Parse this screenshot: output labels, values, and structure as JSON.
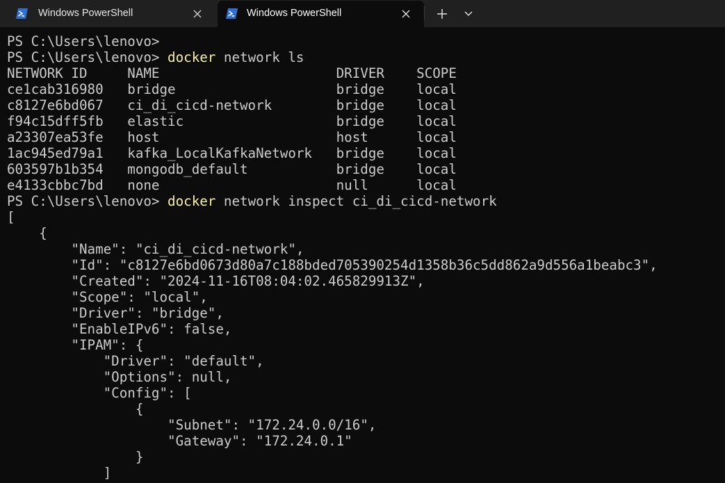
{
  "tabs": [
    {
      "title": "Windows PowerShell",
      "active": false
    },
    {
      "title": "Windows PowerShell",
      "active": true
    }
  ],
  "colors": {
    "background": "#0c0c0c",
    "tabbar": "#202020",
    "text": "#cccccc",
    "command": "#f9f1a5",
    "ps_icon_bg": "#2f6fd6"
  },
  "icons": {
    "tab_icon": "powershell-icon",
    "close": "close-icon",
    "new_tab": "plus-icon",
    "dropdown": "chevron-down-icon"
  },
  "terminal": {
    "lines": [
      {
        "segments": [
          {
            "text": "PS C:\\Users\\lenovo>"
          }
        ]
      },
      {
        "segments": [
          {
            "text": "PS C:\\Users\\lenovo> "
          },
          {
            "text": "docker",
            "style": "cmd"
          },
          {
            "text": " network ls"
          }
        ]
      },
      {
        "segments": [
          {
            "text": "NETWORK ID     NAME                      DRIVER    SCOPE"
          }
        ]
      },
      {
        "segments": [
          {
            "text": "ce1cab316980   bridge                    bridge    local"
          }
        ]
      },
      {
        "segments": [
          {
            "text": "c8127e6bd067   ci_di_cicd-network        bridge    local"
          }
        ]
      },
      {
        "segments": [
          {
            "text": "f94c15dff5fb   elastic                   bridge    local"
          }
        ]
      },
      {
        "segments": [
          {
            "text": "a23307ea53fe   host                      host      local"
          }
        ]
      },
      {
        "segments": [
          {
            "text": "1ac945ed79a1   kafka_LocalKafkaNetwork   bridge    local"
          }
        ]
      },
      {
        "segments": [
          {
            "text": "603597b1b354   mongodb_default           bridge    local"
          }
        ]
      },
      {
        "segments": [
          {
            "text": "e4133cbbc7bd   none                      null      local"
          }
        ]
      },
      {
        "segments": [
          {
            "text": "PS C:\\Users\\lenovo> "
          },
          {
            "text": "docker",
            "style": "cmd"
          },
          {
            "text": " network inspect ci_di_cicd-network"
          }
        ]
      },
      {
        "segments": [
          {
            "text": "["
          }
        ]
      },
      {
        "segments": [
          {
            "text": "    {"
          }
        ]
      },
      {
        "segments": [
          {
            "text": "        \"Name\": \"ci_di_cicd-network\","
          }
        ]
      },
      {
        "segments": [
          {
            "text": "        \"Id\": \"c8127e6bd0673d80a7c188bded705390254d1358b36c5dd862a9d556a1beabc3\","
          }
        ]
      },
      {
        "segments": [
          {
            "text": "        \"Created\": \"2024-11-16T08:04:02.465829913Z\","
          }
        ]
      },
      {
        "segments": [
          {
            "text": "        \"Scope\": \"local\","
          }
        ]
      },
      {
        "segments": [
          {
            "text": "        \"Driver\": \"bridge\","
          }
        ]
      },
      {
        "segments": [
          {
            "text": "        \"EnableIPv6\": false,"
          }
        ]
      },
      {
        "segments": [
          {
            "text": "        \"IPAM\": {"
          }
        ]
      },
      {
        "segments": [
          {
            "text": "            \"Driver\": \"default\","
          }
        ]
      },
      {
        "segments": [
          {
            "text": "            \"Options\": null,"
          }
        ]
      },
      {
        "segments": [
          {
            "text": "            \"Config\": ["
          }
        ]
      },
      {
        "segments": [
          {
            "text": "                {"
          }
        ]
      },
      {
        "segments": [
          {
            "text": "                    \"Subnet\": \"172.24.0.0/16\","
          }
        ]
      },
      {
        "segments": [
          {
            "text": "                    \"Gateway\": \"172.24.0.1\""
          }
        ]
      },
      {
        "segments": [
          {
            "text": "                }"
          }
        ]
      },
      {
        "segments": [
          {
            "text": "            ]"
          }
        ]
      }
    ]
  }
}
